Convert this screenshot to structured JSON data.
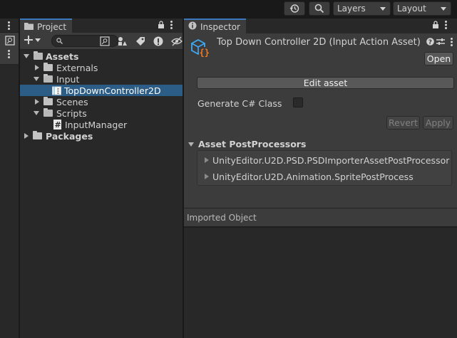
{
  "toolbar": {
    "history_icon": "history-icon",
    "search_icon": "search-icon",
    "layers_label": "Layers",
    "layout_label": "Layout"
  },
  "project": {
    "tab_label": "Project",
    "tree": [
      {
        "label": "Assets",
        "bold": true,
        "expanded": true,
        "icon": "folder-open-icon"
      },
      {
        "label": "Externals",
        "bold": false,
        "expanded": false,
        "icon": "folder-icon"
      },
      {
        "label": "Input",
        "bold": false,
        "expanded": true,
        "icon": "folder-open-icon"
      },
      {
        "label": "TopDownController2D",
        "bold": false,
        "selected": true,
        "icon": "input-action-asset-icon"
      },
      {
        "label": "Scenes",
        "bold": false,
        "expanded": false,
        "icon": "folder-icon"
      },
      {
        "label": "Scripts",
        "bold": false,
        "expanded": true,
        "icon": "folder-open-icon"
      },
      {
        "label": "InputManager",
        "bold": false,
        "icon": "csharp-script-icon"
      },
      {
        "label": "Packages",
        "bold": true,
        "expanded": false,
        "icon": "folder-icon"
      }
    ]
  },
  "inspector": {
    "tab_label": "Inspector",
    "asset_title": "Top Down Controller 2D (Input Action Asset)",
    "open_button": "Open",
    "edit_asset_button": "Edit asset",
    "generate_label": "Generate C# Class",
    "generate_checked": false,
    "revert_button": "Revert",
    "apply_button": "Apply",
    "postprocessors_header": "Asset PostProcessors",
    "postprocessors": [
      "UnityEditor.U2D.PSD.PSDImporterAssetPostProcessor",
      "UnityEditor.U2D.Animation.SpritePostProcess"
    ],
    "imported_object_label": "Imported Object"
  },
  "colors": {
    "selection": "#2c5d87",
    "tab_accent": "#3a79bb",
    "asset_icon_blue": "#3fa9f5",
    "asset_icon_orange": "#f47a20"
  }
}
